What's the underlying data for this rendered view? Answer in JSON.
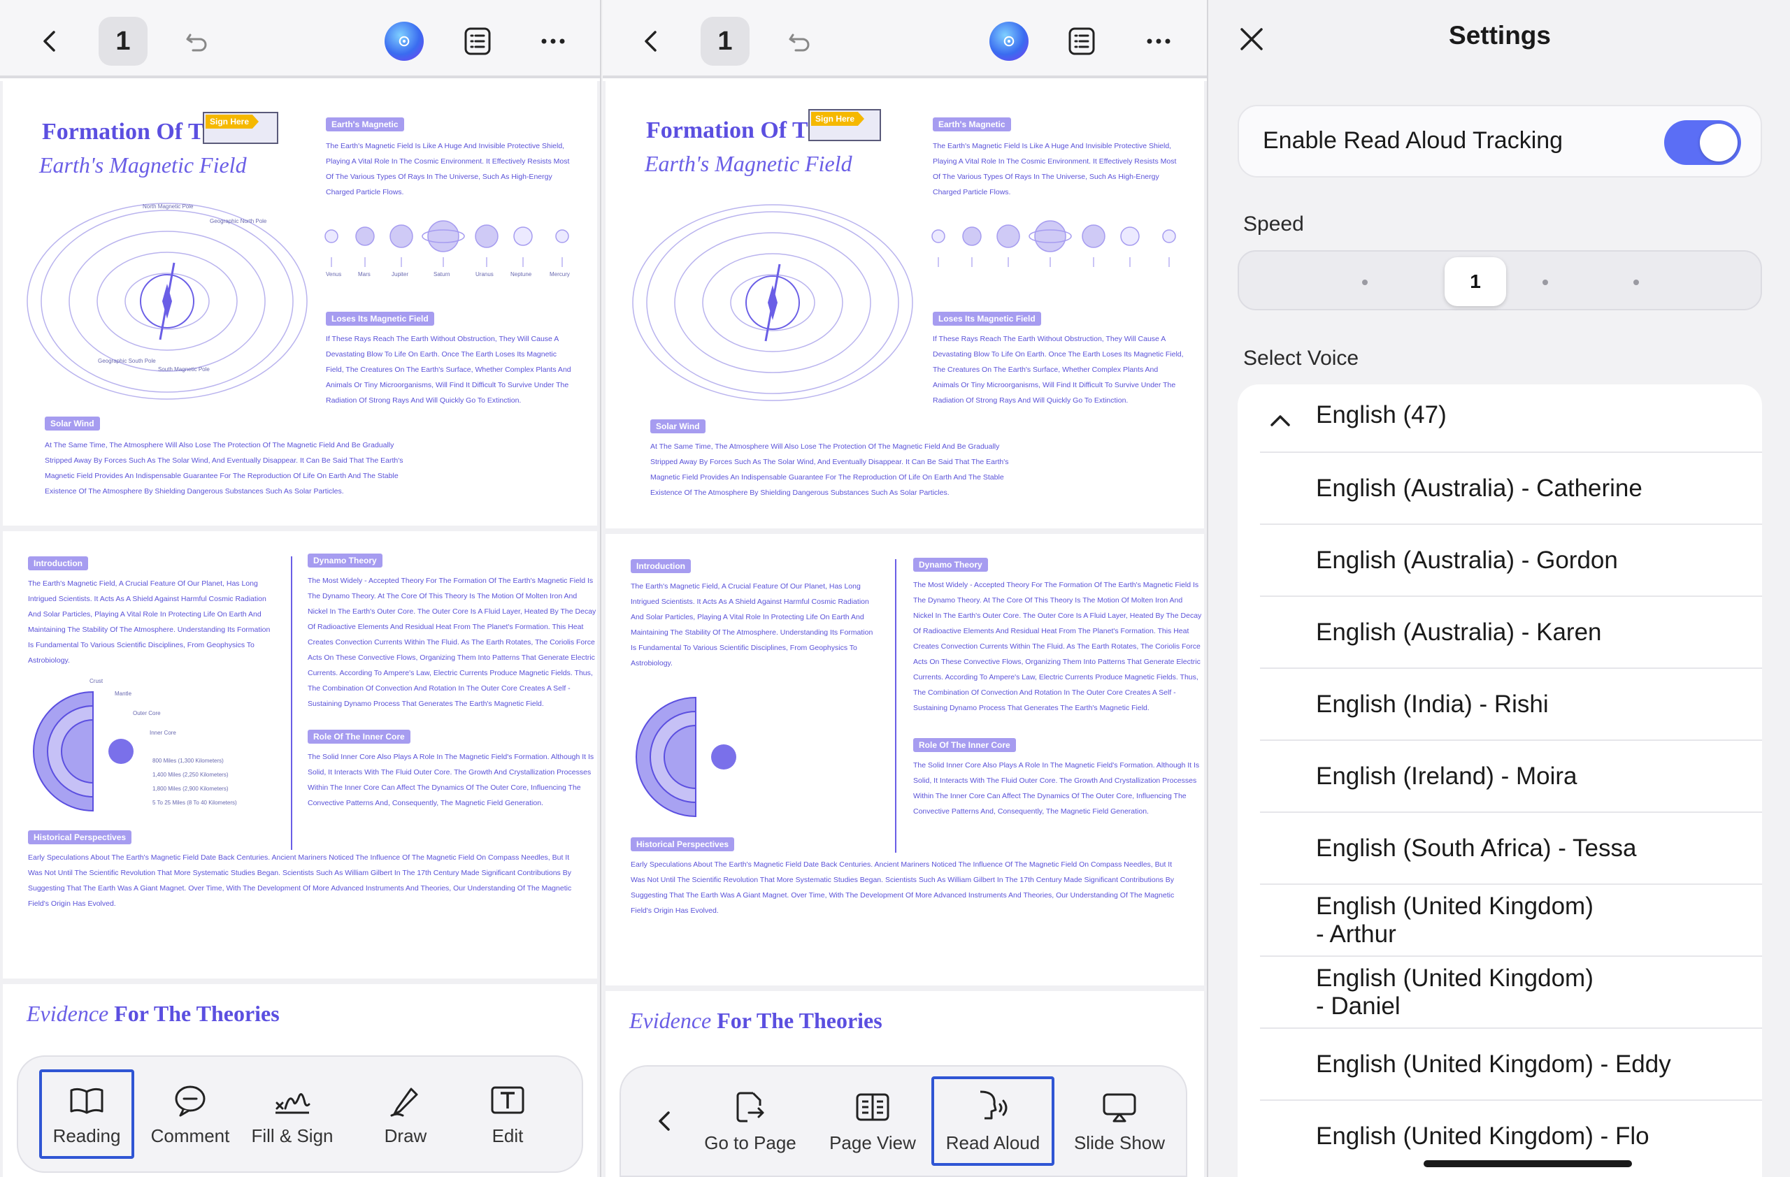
{
  "left_pane": {
    "page_number": "1",
    "document": {
      "title_line1": "Formation Of T",
      "title_line2": "Earth's Magnetic Field",
      "sign_here": "Sign Here",
      "section_earths_magnetic": "Earth's Magnetic",
      "section_loses": "Loses Its Magnetic Field",
      "section_solar_wind": "Solar Wind",
      "section_introduction": "Introduction",
      "section_dynamo": "Dynamo Theory",
      "section_inner_core": "Role Of The Inner Core",
      "section_historical": "Historical Perspectives",
      "evidence_italic": "Evidence",
      "evidence_rest": "For The Theories",
      "para_magnetic": "The Earth's Magnetic Field Is Like A Huge And Invisible Protective Shield, Playing A Vital Role In The Cosmic Environment. It Effectively Resists Most Of The Various Types Of Rays In The Universe, Such As High-Energy Charged Particle Flows.",
      "para_loses": "If These Rays Reach The Earth Without Obstruction, They Will Cause A Devastating Blow To Life On Earth. Once The Earth Loses Its Magnetic Field, The Creatures On The Earth's Surface, Whether Complex Plants And Animals Or Tiny Microorganisms, Will Find It Difficult To Survive Under The Radiation Of Strong Rays And Will Quickly Go To Extinction.",
      "para_solar": "At The Same Time, The Atmosphere Will Also Lose The Protection Of The Magnetic Field And Be Gradually Stripped Away By Forces Such As The Solar Wind, And Eventually Disappear. It Can Be Said That The Earth's Magnetic Field Provides An Indispensable Guarantee For The Reproduction Of Life On Earth And The Stable Existence Of The Atmosphere By Shielding Dangerous Substances Such As Solar Particles.",
      "para_intro": "The Earth's Magnetic Field, A Crucial Feature Of Our Planet, Has Long Intrigued Scientists. It Acts As A Shield Against Harmful Cosmic Radiation And Solar Particles, Playing A Vital Role In Protecting Life On Earth And Maintaining The Stability Of The Atmosphere. Understanding Its Formation Is Fundamental To Various Scientific Disciplines, From Geophysics To Astrobiology.",
      "para_dynamo": "The Most Widely - Accepted Theory For The Formation Of The Earth's Magnetic Field Is The Dynamo Theory. At The Core Of This Theory Is The Motion Of Molten Iron And Nickel In The Earth's Outer Core. The Outer Core Is A Fluid Layer, Heated By The Decay Of Radioactive Elements And Residual Heat From The Planet's Formation. This Heat Creates Convection Currents Within The Fluid. As The Earth Rotates, The Coriolis Force Acts On These Convective Flows, Organizing Them Into Patterns That Generate Electric Currents. According To Ampere's Law, Electric Currents Produce Magnetic Fields. Thus, The Combination Of Convection And Rotation In The Outer Core Creates A Self - Sustaining Dynamo Process That Generates The Earth's Magnetic Field.",
      "para_inner": "The Solid Inner Core Also Plays A Role In The Magnetic Field's Formation. Although It Is Solid, It Interacts With The Fluid Outer Core. The Growth And Crystallization Processes Within The Inner Core Can Affect The Dynamics Of The Outer Core, Influencing The Convective Patterns And, Consequently, The Magnetic Field Generation.",
      "para_hist": "Early Speculations About The Earth's Magnetic Field Date Back Centuries. Ancient Mariners Noticed The Influence Of The Magnetic Field On Compass Needles, But It Was Not Until The Scientific Revolution That More Systematic Studies Began. Scientists Such As William Gilbert In The 17th Century Made Significant Contributions By Suggesting That The Earth Was A Giant Magnet. Over Time, With The Development Of More Advanced Instruments And Theories, Our Understanding Of The Magnetic Field's Origin Has Evolved.",
      "planet_labels": [
        "Venus",
        "Mars",
        "Jupiter",
        "Saturn",
        "Uranus",
        "Neptune",
        "Mercury"
      ],
      "globe_labels": [
        "Geographic North Pole",
        "Geographic South Pole",
        "North Magnetic Pole",
        "South Magnetic Pole"
      ],
      "core_labels": [
        "Crust",
        "Mantle",
        "Outer Core",
        "Inner Core"
      ],
      "core_distances": [
        "800 Miles (1,300 Kilometers)",
        "1,400 Miles (2,250 Kilometers)",
        "1,800 Miles (2,900 Kilometers)",
        "5 To 25 Miles (8 To 40 Kilometers)"
      ]
    },
    "toolbar": {
      "reading": "Reading",
      "comment": "Comment",
      "fill_sign": "Fill & Sign",
      "draw": "Draw",
      "edit": "Edit"
    }
  },
  "middle_pane": {
    "page_number": "1",
    "toolbar": {
      "go_to_page": "Go to Page",
      "page_view": "Page View",
      "read_aloud": "Read Aloud",
      "slide_show": "Slide Show"
    }
  },
  "settings": {
    "title": "Settings",
    "tracking_label": "Enable Read Aloud Tracking",
    "tracking_enabled": true,
    "speed_label": "Speed",
    "speed_value": "1",
    "select_voice_label": "Select Voice",
    "group": "English (47)",
    "voices": [
      "English (Australia) - Catherine",
      "English (Australia) - Gordon",
      "English (Australia) - Karen",
      "English (India) - Rishi",
      "English (Ireland) - Moira",
      "English (South Africa) - Tessa",
      "English (United Kingdom)\n- Arthur",
      "English (United Kingdom)\n- Daniel",
      "English (United Kingdom) - Eddy",
      "English (United Kingdom) - Flo"
    ]
  },
  "colors": {
    "accent": "#5b6ef5",
    "doc_purple": "#5b4fe0",
    "tag_purple": "#a69cf0",
    "active_outline": "#2f55d4",
    "sign_yellow": "#f5b800"
  }
}
